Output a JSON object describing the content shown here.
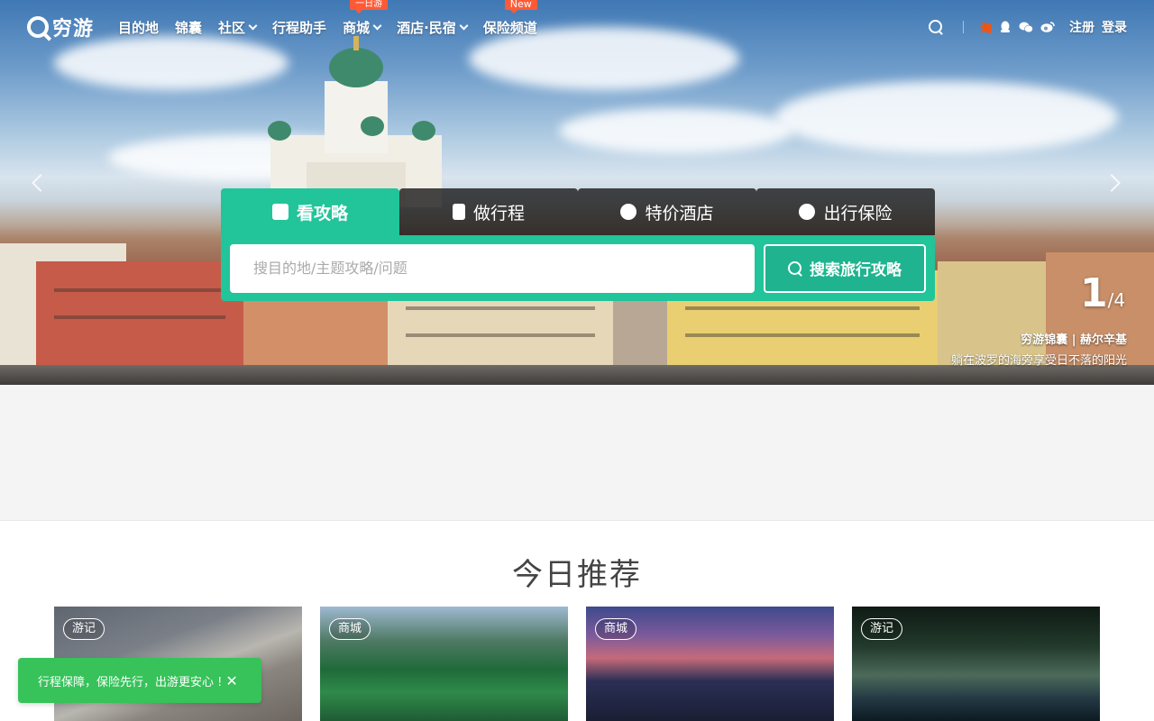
{
  "nav": {
    "logo": "穷游",
    "items": [
      {
        "label": "目的地"
      },
      {
        "label": "锦囊"
      },
      {
        "label": "社区"
      },
      {
        "label": "行程助手"
      },
      {
        "label": "商城",
        "tag": "一日游"
      },
      {
        "label": "酒店·民宿"
      },
      {
        "label": "保险频道",
        "tag": "New"
      }
    ],
    "social": {
      "taobao": "淘"
    },
    "register": "注册",
    "login": "登录"
  },
  "hero": {
    "counter_current": "1",
    "counter_total": "/4",
    "caption_title": "穷游锦囊 | 赫尔辛基",
    "caption_text": "躺在波罗的海旁享受日不落的阳光"
  },
  "search": {
    "tabs": [
      {
        "label": "看攻略",
        "icon": "bookmark-icon",
        "active": true
      },
      {
        "label": "做行程",
        "icon": "document-icon",
        "active": false
      },
      {
        "label": "特价酒店",
        "icon": "hotel-icon",
        "active": false
      },
      {
        "label": "出行保险",
        "icon": "shield-icon",
        "active": false
      }
    ],
    "placeholder": "搜目的地/主题攻略/问题",
    "button_label": "搜索旅行攻略"
  },
  "recommend": {
    "title": "今日推荐",
    "cards": [
      {
        "badge": "游记"
      },
      {
        "badge": "商城"
      },
      {
        "badge": "商城"
      },
      {
        "badge": "游记"
      }
    ]
  },
  "toast": {
    "text": "行程保障，保险先行，出游更安心 !",
    "close": "✕"
  },
  "colors": {
    "accent": "#22c49a",
    "toast": "#37c25a",
    "tag": "#ff5a36"
  }
}
